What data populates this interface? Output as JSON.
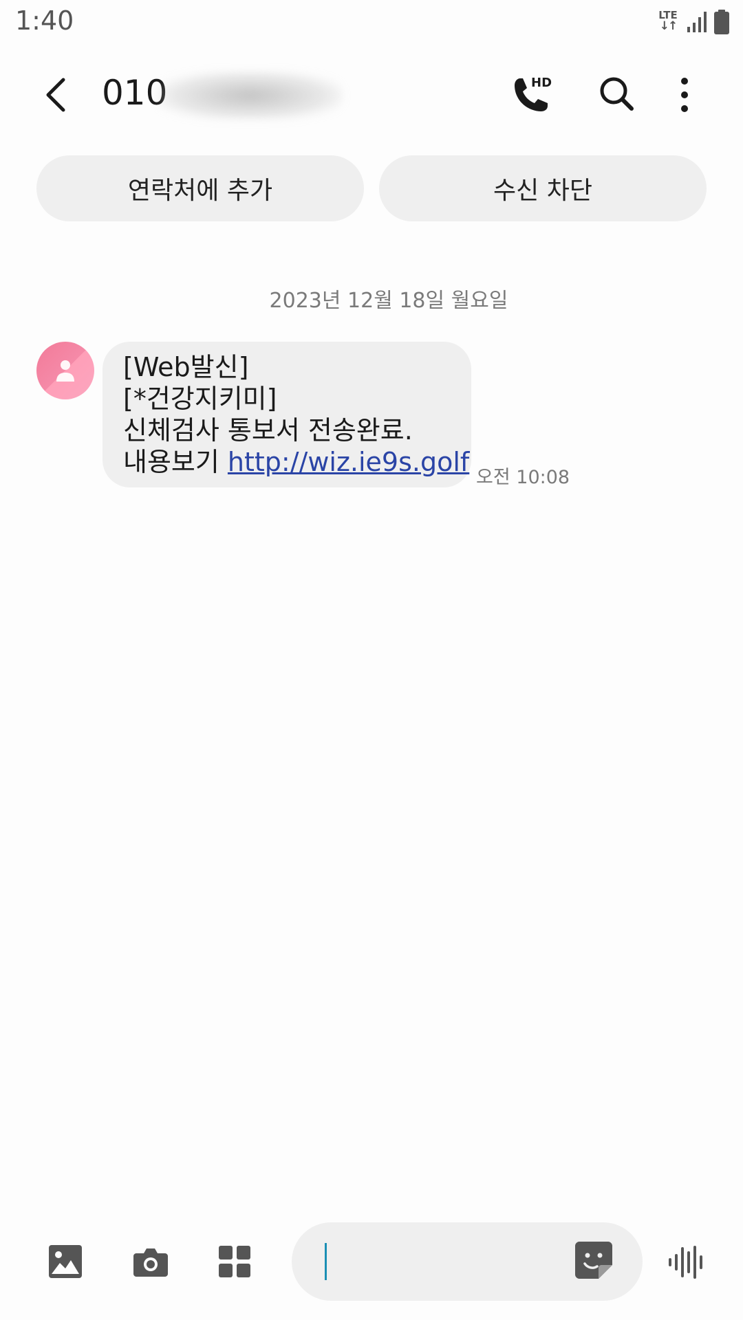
{
  "status_bar": {
    "time": "1:40",
    "network_label": "LTE",
    "icons": [
      "lte-data-icon",
      "signal-icon",
      "battery-icon"
    ]
  },
  "header": {
    "contact_number_visible": "010",
    "icons": [
      "back-arrow-icon",
      "hd-call-icon",
      "search-icon",
      "more-vert-icon"
    ],
    "hd_badge": "HD"
  },
  "actions": {
    "add_contact": "연락처에 추가",
    "block_number": "수신 차단"
  },
  "conversation": {
    "date": "2023년 12월 18일 월요일",
    "messages": [
      {
        "lines": [
          "[Web발신]",
          "[*건강지키미]",
          "신체검사 통보서 전송완료."
        ],
        "last_line_prefix": "내용보기 ",
        "link": "http://wiz.ie9s.golf",
        "time": "오전 10:08"
      }
    ]
  },
  "composer": {
    "input_value": "",
    "input_placeholder": "",
    "icons": [
      "gallery-icon",
      "camera-icon",
      "apps-grid-icon",
      "sticker-icon",
      "voice-waveform-icon"
    ]
  },
  "colors": {
    "background": "#fdfdfd",
    "chip": "#efefef",
    "bubble": "#efefef",
    "link": "#2a44a6",
    "caret": "#1b8fb4",
    "avatar": "#f58aa8",
    "icon": "#555555"
  }
}
